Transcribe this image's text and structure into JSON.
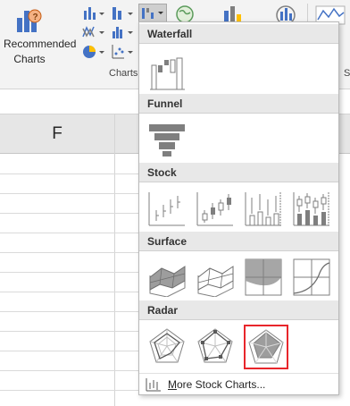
{
  "ribbon": {
    "recommended_line1": "Recommended",
    "recommended_line2": "Charts",
    "group_label": "Charts",
    "group_label_2": "S"
  },
  "sheet": {
    "column_header": "F"
  },
  "gallery": {
    "sections": [
      {
        "id": "waterfall",
        "title": "Waterfall"
      },
      {
        "id": "funnel",
        "title": "Funnel"
      },
      {
        "id": "stock",
        "title": "Stock"
      },
      {
        "id": "surface",
        "title": "Surface"
      },
      {
        "id": "radar",
        "title": "Radar"
      }
    ],
    "more_prefix": "M",
    "more_rest": "ore Stock Charts..."
  },
  "colors": {
    "selected_outline": "#e8262b",
    "section_header_bg": "#e8e8e8",
    "gallery_bg": "#ffffff",
    "ribbon_bg": "#f3f3f3",
    "chart_blue": "#2e75b6",
    "chart_gray": "#7f7f7f"
  }
}
